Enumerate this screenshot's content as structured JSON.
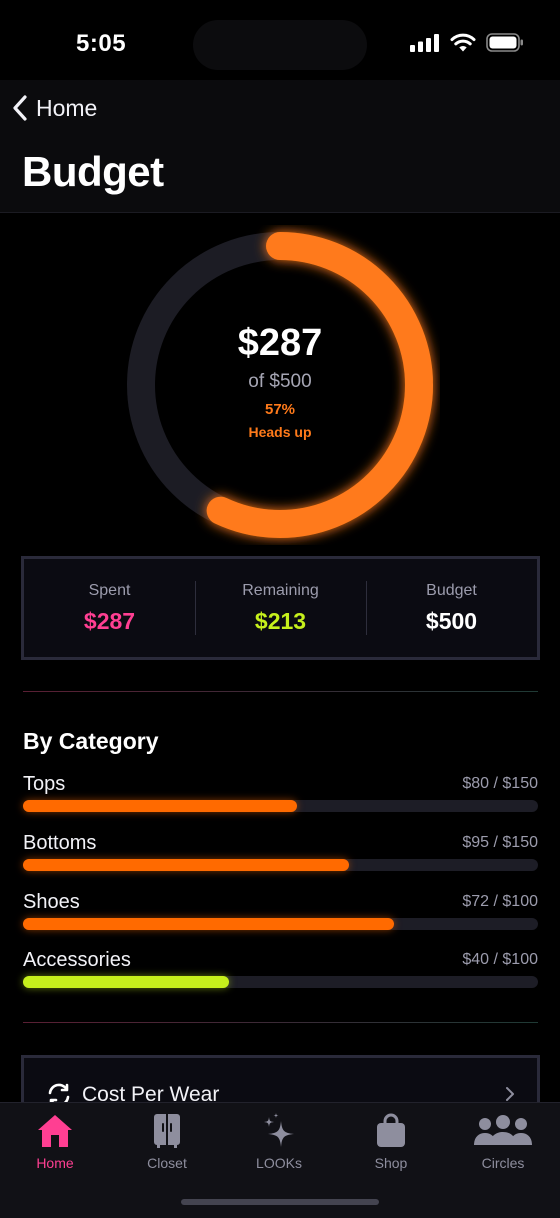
{
  "status_bar": {
    "time": "5:05"
  },
  "nav": {
    "back_label": "Home",
    "title": "Budget"
  },
  "ring": {
    "spent": "$287",
    "of_total": "of $500",
    "percent_label": "57%",
    "status": "Heads up",
    "progress": 0.57,
    "color": "#ff7a1a"
  },
  "stats": [
    {
      "label": "Spent",
      "value": "$287",
      "color": "#ff3f92"
    },
    {
      "label": "Remaining",
      "value": "$213",
      "color": "#c6f01c"
    },
    {
      "label": "Budget",
      "value": "$500",
      "color": "#ffffff"
    }
  ],
  "categories": {
    "title": "By Category",
    "items": [
      {
        "name": "Tops",
        "amount": "$80 / $150",
        "progress": 0.533,
        "color": "#ff6a00"
      },
      {
        "name": "Bottoms",
        "amount": "$95 / $150",
        "progress": 0.633,
        "color": "#ff6a00"
      },
      {
        "name": "Shoes",
        "amount": "$72 / $100",
        "progress": 0.72,
        "color": "#ff6a00"
      },
      {
        "name": "Accessories",
        "amount": "$40 / $100",
        "progress": 0.4,
        "color": "#c6f01c"
      }
    ]
  },
  "cost_per_wear": {
    "label": "Cost Per Wear"
  },
  "tabs": [
    {
      "label": "Home",
      "icon": "home-icon",
      "active": true
    },
    {
      "label": "Closet",
      "icon": "closet-icon",
      "active": false
    },
    {
      "label": "LOOKs",
      "icon": "sparkles-icon",
      "active": false
    },
    {
      "label": "Shop",
      "icon": "shopping-bag-icon",
      "active": false
    },
    {
      "label": "Circles",
      "icon": "people-icon",
      "active": false
    }
  ]
}
